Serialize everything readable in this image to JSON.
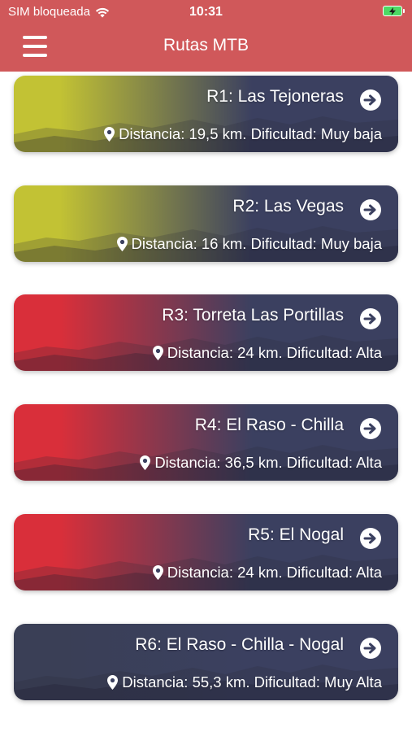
{
  "status_bar": {
    "carrier": "SIM bloqueada",
    "time": "10:31",
    "wifi_icon": "wifi-icon",
    "battery_icon": "battery-charging-icon"
  },
  "nav": {
    "title": "Rutas MTB",
    "menu_icon": "hamburger-menu-icon"
  },
  "routes": [
    {
      "title": "R1: Las Tejoneras",
      "info": "Distancia: 19,5 km. Dificultad: Muy baja",
      "color": "#c2c234"
    },
    {
      "title": "R2: Las Vegas",
      "info": "Distancia: 16 km. Dificultad: Muy baja",
      "color": "#c2c234"
    },
    {
      "title": "R3: Torreta Las Portillas",
      "info": "Distancia: 24 km. Dificultad: Alta",
      "color": "#d92f3a"
    },
    {
      "title": "R4: El Raso - Chilla",
      "info": "Distancia: 36,5 km. Dificultad: Alta",
      "color": "#d92f3a"
    },
    {
      "title": "R5: El Nogal",
      "info": "Distancia: 24 km. Dificultad: Alta",
      "color": "#d92f3a"
    },
    {
      "title": "R6: El Raso - Chilla - Nogal",
      "info": "Distancia: 55,3 km. Dificultad: Muy Alta",
      "color": "#3a3f56"
    }
  ],
  "card_dark_color": "#3b4060",
  "header_color": "#d0585a"
}
